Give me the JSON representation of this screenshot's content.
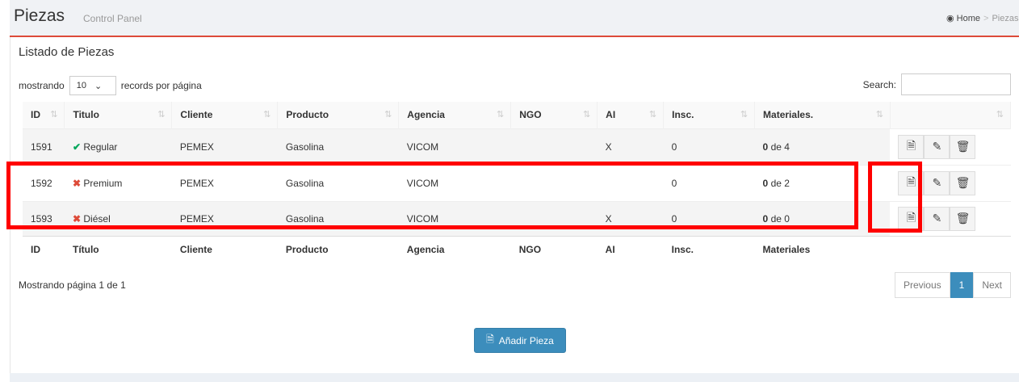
{
  "header": {
    "title": "Piezas",
    "subtitle": "Control Panel",
    "breadcrumb": [
      "Home",
      "Piezas"
    ]
  },
  "box": {
    "title": "Listado de Piezas"
  },
  "length": {
    "prefix": "mostrando",
    "value": "10",
    "suffix": "records por página"
  },
  "search": {
    "label": "Search:",
    "value": ""
  },
  "table": {
    "headers": [
      "ID",
      "Titulo",
      "Cliente",
      "Producto",
      "Agencia",
      "NGO",
      "AI",
      "Insc.",
      "Materiales.",
      ""
    ],
    "footer": [
      "ID",
      "Título",
      "Cliente",
      "Producto",
      "Agencia",
      "NGO",
      "AI",
      "Insc.",
      "Materiales",
      ""
    ],
    "rows": [
      {
        "id": "1591",
        "status": "ok",
        "titulo": "Regular",
        "cliente": "PEMEX",
        "producto": "Gasolina",
        "agencia": "VICOM",
        "ngo": "",
        "ai": "X",
        "insc": "0",
        "mat_bold": "0",
        "mat_rest": " de 4"
      },
      {
        "id": "1592",
        "status": "bad",
        "titulo": "Premium",
        "cliente": "PEMEX",
        "producto": "Gasolina",
        "agencia": "VICOM",
        "ngo": "",
        "ai": "",
        "insc": "0",
        "mat_bold": "0",
        "mat_rest": " de 2"
      },
      {
        "id": "1593",
        "status": "bad",
        "titulo": "Diésel",
        "cliente": "PEMEX",
        "producto": "Gasolina",
        "agencia": "VICOM",
        "ngo": "",
        "ai": "X",
        "insc": "0",
        "mat_bold": "0",
        "mat_rest": " de 0"
      }
    ]
  },
  "info": "Mostrando página 1 de 1",
  "pager": {
    "prev": "Previous",
    "current": "1",
    "next": "Next"
  },
  "add_button": "Añadir Pieza",
  "colors": {
    "accent": "#3c8dbc",
    "ok": "#00a65a",
    "bad": "#dd4b39",
    "highlight": "#ff0000"
  }
}
